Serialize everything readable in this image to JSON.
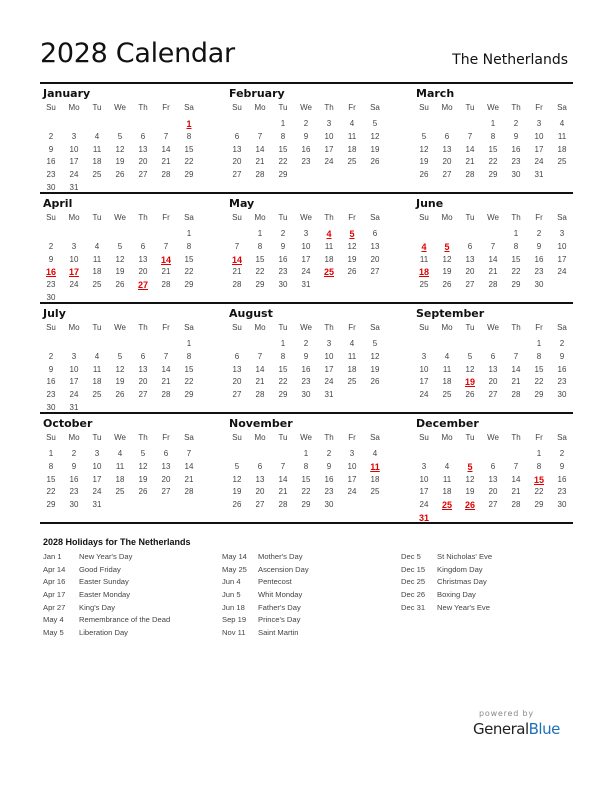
{
  "header": {
    "title": "2028 Calendar",
    "country": "The Netherlands"
  },
  "weekdays": [
    "Su",
    "Mo",
    "Tu",
    "We",
    "Th",
    "Fr",
    "Sa"
  ],
  "colors": {
    "holiday": "#e00000",
    "text": "#444444",
    "rule": "#111111",
    "brand_blue": "#1f6fb8"
  },
  "months": [
    {
      "name": "January",
      "start": 6,
      "days": 31,
      "holidays": [
        1
      ]
    },
    {
      "name": "February",
      "start": 2,
      "days": 29,
      "holidays": []
    },
    {
      "name": "March",
      "start": 3,
      "days": 31,
      "holidays": []
    },
    {
      "name": "April",
      "start": 6,
      "days": 30,
      "holidays": [
        14,
        16,
        17,
        27
      ]
    },
    {
      "name": "May",
      "start": 1,
      "days": 31,
      "holidays": [
        4,
        5,
        14,
        25
      ]
    },
    {
      "name": "June",
      "start": 4,
      "days": 30,
      "holidays": [
        4,
        5,
        18
      ]
    },
    {
      "name": "July",
      "start": 6,
      "days": 31,
      "holidays": []
    },
    {
      "name": "August",
      "start": 2,
      "days": 31,
      "holidays": []
    },
    {
      "name": "September",
      "start": 5,
      "days": 30,
      "holidays": [
        19
      ]
    },
    {
      "name": "October",
      "start": 0,
      "days": 31,
      "holidays": []
    },
    {
      "name": "November",
      "start": 3,
      "days": 30,
      "holidays": [
        11
      ]
    },
    {
      "name": "December",
      "start": 5,
      "days": 31,
      "holidays": [
        5,
        15,
        25,
        26,
        31
      ]
    }
  ],
  "holidays_section": {
    "title": "2028 Holidays for The Netherlands",
    "columns": [
      [
        {
          "date": "Jan 1",
          "name": "New Year's Day"
        },
        {
          "date": "Apr 14",
          "name": "Good Friday"
        },
        {
          "date": "Apr 16",
          "name": "Easter Sunday"
        },
        {
          "date": "Apr 17",
          "name": "Easter Monday"
        },
        {
          "date": "Apr 27",
          "name": "King's Day"
        },
        {
          "date": "May 4",
          "name": "Remembrance of the Dead"
        },
        {
          "date": "May 5",
          "name": "Liberation Day"
        }
      ],
      [
        {
          "date": "May 14",
          "name": "Mother's Day"
        },
        {
          "date": "May 25",
          "name": "Ascension Day"
        },
        {
          "date": "Jun 4",
          "name": "Pentecost"
        },
        {
          "date": "Jun 5",
          "name": "Whit Monday"
        },
        {
          "date": "Jun 18",
          "name": "Father's Day"
        },
        {
          "date": "Sep 19",
          "name": "Prince's Day"
        },
        {
          "date": "Nov 11",
          "name": "Saint Martin"
        }
      ],
      [
        {
          "date": "Dec 5",
          "name": "St Nicholas' Eve"
        },
        {
          "date": "Dec 15",
          "name": "Kingdom Day"
        },
        {
          "date": "Dec 25",
          "name": "Christmas Day"
        },
        {
          "date": "Dec 26",
          "name": "Boxing Day"
        },
        {
          "date": "Dec 31",
          "name": "New Year's Eve"
        }
      ]
    ]
  },
  "footer": {
    "powered_by": "powered by",
    "brand_general": "General",
    "brand_blue": "Blue"
  }
}
